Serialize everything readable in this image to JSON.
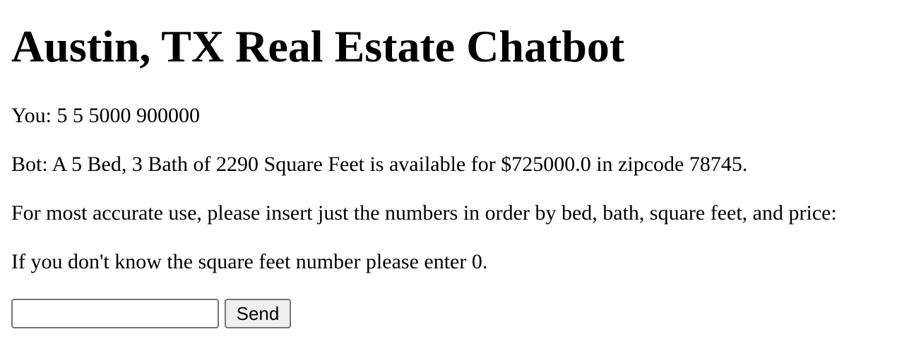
{
  "title": "Austin, TX Real Estate Chatbot",
  "conversation": [
    {
      "speaker": "You",
      "text": "You: 5 5 5000 900000"
    },
    {
      "speaker": "Bot",
      "text": "Bot: A 5 Bed, 3 Bath of 2290 Square Feet is available for $725000.0 in zipcode 78745."
    }
  ],
  "instructions": [
    "For most accurate use, please insert just the numbers in order by bed, bath, square feet, and price:",
    "If you don't know the square feet number please enter 0."
  ],
  "form": {
    "input_value": "",
    "input_placeholder": "",
    "send_label": "Send"
  }
}
